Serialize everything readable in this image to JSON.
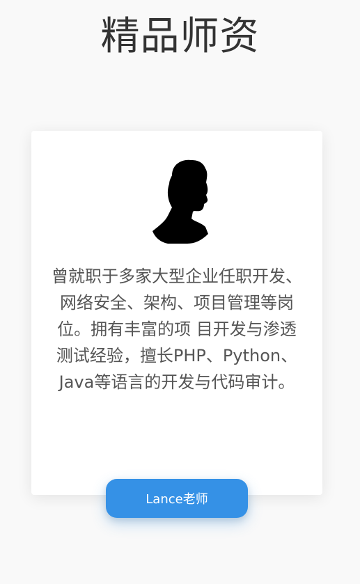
{
  "section": {
    "title": "精品师资"
  },
  "teacher_card": {
    "avatar_icon": "person-silhouette-icon",
    "bio": "曾就职于多家大型企业任职开发、网络安全、架构、项目管理等岗位。拥有丰富的项 目开发与渗透测试经验，擅长PHP、Python、Java等语言的开发与代码审计。",
    "name_button_label": "Lance老师"
  },
  "colors": {
    "background": "#f9f9f9",
    "card": "#ffffff",
    "accent": "#3591e6",
    "title_text": "#333333",
    "body_text": "#555555"
  }
}
